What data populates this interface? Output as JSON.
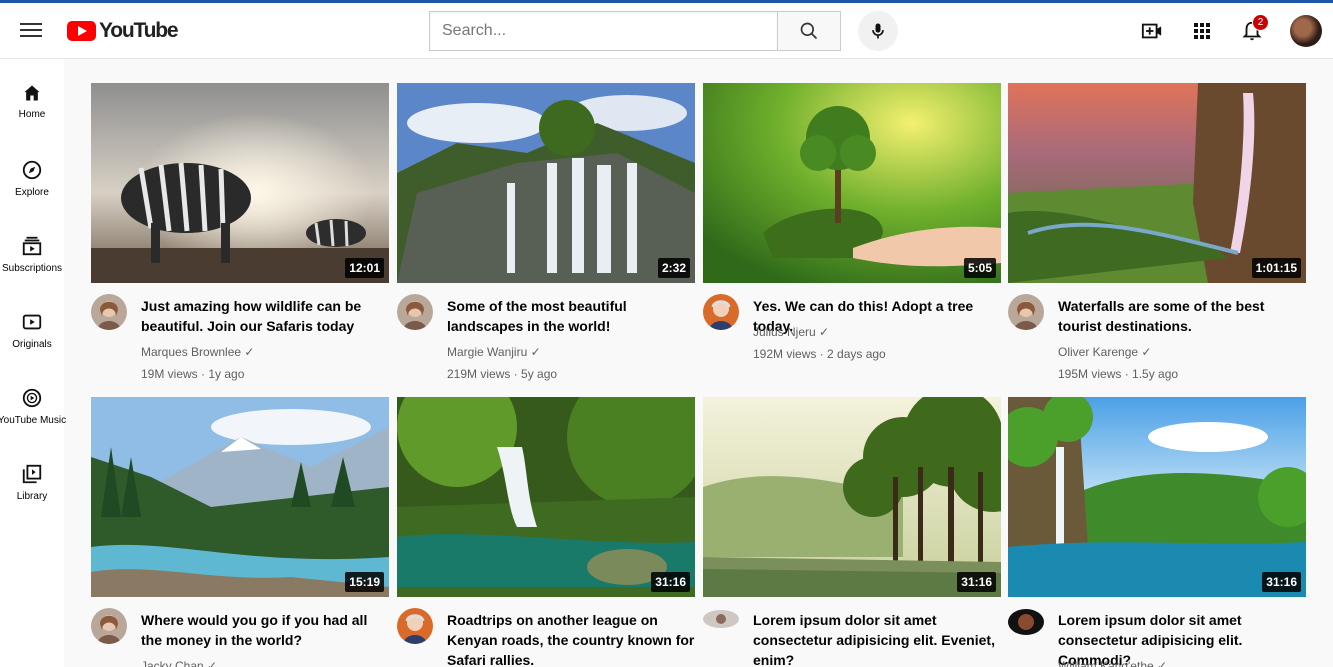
{
  "header": {
    "logo_text": "YouTube",
    "search_placeholder": "Search...",
    "notification_count": "2"
  },
  "nav": [
    {
      "label": "Home",
      "icon": "home-icon"
    },
    {
      "label": "Explore",
      "icon": "compass-icon"
    },
    {
      "label": "Subscriptions",
      "icon": "subscriptions-icon"
    },
    {
      "label": "Originals",
      "icon": "originals-icon"
    },
    {
      "label": "YouTube Music",
      "icon": "music-icon"
    },
    {
      "label": "Library",
      "icon": "library-icon"
    }
  ],
  "videos": [
    {
      "title": "Just amazing how wildlife can be beautiful. Join our Safaris today",
      "channel": "Marques Brownlee ✓",
      "meta": "19M views · 1y ago",
      "duration": "12:01"
    },
    {
      "title": "Some of the most beautiful landscapes in the world!",
      "channel": "Margie Wanjiru ✓",
      "meta": "219M views · 5y ago",
      "duration": "2:32"
    },
    {
      "title": "Yes. We can do this! Adopt a tree today.",
      "channel": "Julius Njeru ✓",
      "meta": "192M views · 2 days ago",
      "duration": "5:05"
    },
    {
      "title": "Waterfalls are some of the best tourist destinations.",
      "channel": "Oliver Karenge ✓",
      "meta": "195M views · 1.5y ago",
      "duration": "1:01:15"
    },
    {
      "title": "Where would you go if you had all the money in the world?",
      "channel": "Jacky Chan ✓",
      "meta": "",
      "duration": "15:19"
    },
    {
      "title": "Roadtrips on another league on Kenyan roads, the country known for Safari rallies.",
      "channel": "",
      "meta": "",
      "duration": "31:16"
    },
    {
      "title": "Lorem ipsum dolor sit amet consectetur adipisicing elit. Eveniet, enim?",
      "channel": "",
      "meta": "",
      "duration": "31:16"
    },
    {
      "title": "Lorem ipsum dolor sit amet consectetur adipisicing elit. Commodi?",
      "channel": "William Kang'ethe ✓",
      "meta": "",
      "duration": "31:16"
    }
  ]
}
